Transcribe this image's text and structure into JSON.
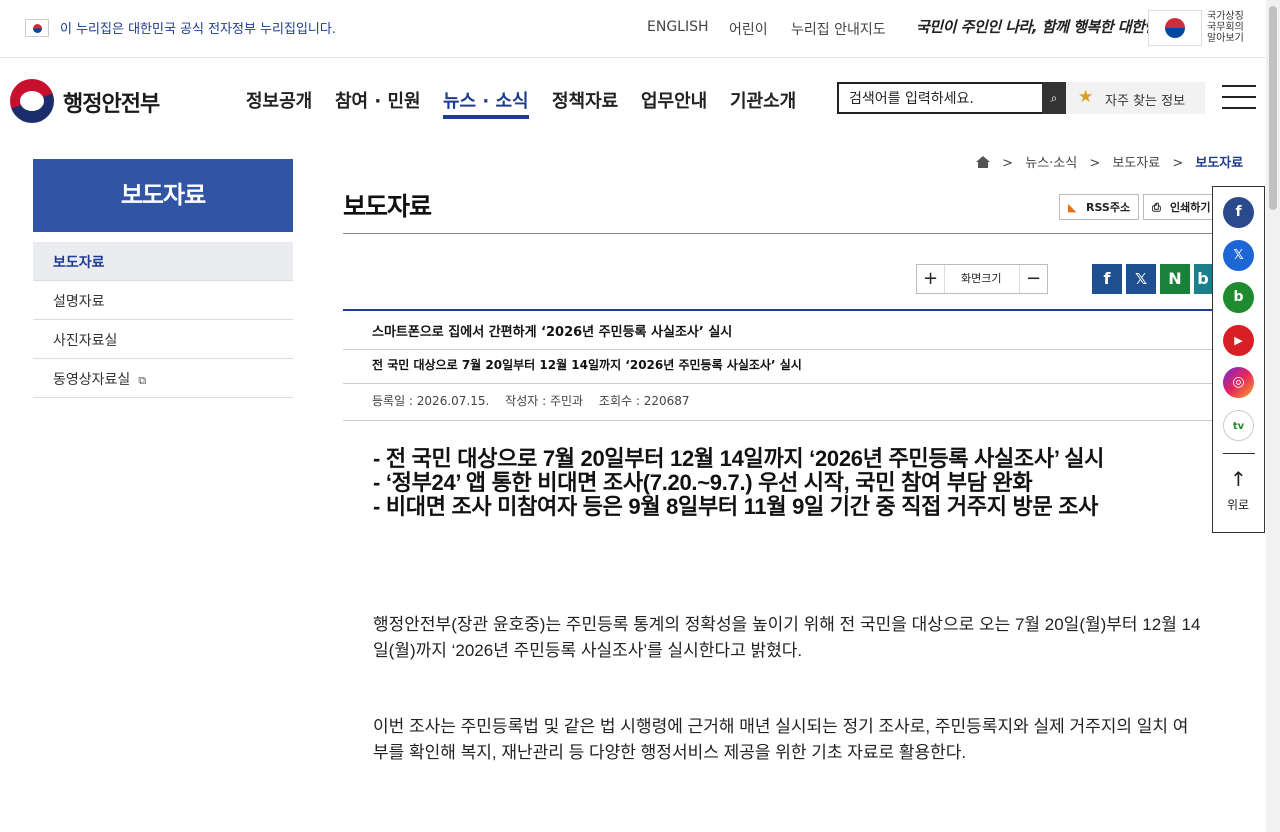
{
  "gov_banner": {
    "notice": "이 누리집은 대한민국 공식 전자정부 누리집입니다.",
    "links": [
      "ENGLISH",
      "어린이",
      "누리집 안내지도"
    ],
    "slogan": "국민이 주인인 나라, 함께 행복한 대한민국",
    "symbol_text": "국가상징\n국무회의\n알아보기"
  },
  "header": {
    "logo_text": "행정안전부",
    "nav": [
      "정보공개",
      "참여 · 민원",
      "뉴스 · 소식",
      "정책자료",
      "업무안내",
      "기관소개"
    ],
    "active_nav": "뉴스 · 소식",
    "search_placeholder": "검색어를 입력하세요.",
    "favorites": "자주 찾는 정보"
  },
  "lnb": {
    "title": "보도자료",
    "items": [
      "보도자료",
      "설명자료",
      "사진자료실",
      "동영상자료실"
    ]
  },
  "breadcrumb": [
    "뉴스·소식",
    "보도자료",
    "보도자료"
  ],
  "content": {
    "page_title": "보도자료",
    "rss": "RSS주소",
    "print": "인쇄하기",
    "zoom_label": "화면크기",
    "zoom_plus": "+",
    "zoom_minus": "−"
  },
  "share": [
    "f",
    "𝕏",
    "N",
    "b"
  ],
  "article": {
    "title": "스마트폰으로 집에서 간편하게 ‘2026년 주민등록 사실조사’ 실시",
    "subtitle": "전 국민 대상으로 7월 20일부터 12월 14일까지 ‘2026년 주민등록 사실조사’ 실시",
    "meta": {
      "date": "등록일 : 2026.07.15.",
      "author": "작성자 : 주민과",
      "views": "조회수 : 220687"
    },
    "summary": [
      "- 전 국민 대상으로 7월 20일부터 12월 14일까지 ‘2026년 주민등록 사실조사’ 실시",
      "- ‘정부24’ 앱 통한 비대면 조사(7.20.~9.7.) 우선 시작, 국민 참여 부담 완화",
      "- 비대면 조사 미참여자 등은 9월 8일부터 11월 9일 기간 중 직접 거주지 방문 조사"
    ],
    "paragraphs": [
      "행정안전부(장관 윤호중)는 주민등록 통계의 정확성을 높이기 위해 전 국민을 대상으로 오는 7월 20일(월)부터 12월 14일(월)까지 ‘2026년 주민등록 사실조사’를 실시한다고 밝혔다.",
      "이번 조사는 주민등록법 및 같은 법 시행령에 근거해 매년 실시되는 정기 조사로, 주민등록지와 실제 거주지의 일치 여부를 확인해 복지, 재난관리 등 다양한 행정서비스 제공을 위한 기초 자료로 활용한다."
    ]
  },
  "quick_menu": {
    "icons": [
      "f",
      "𝕏",
      "b",
      "▶",
      "◎",
      "tv"
    ],
    "up_label": "위로",
    "up_arrow": "↑"
  },
  "colors": {
    "primary": "#1d3c8f",
    "lnb_title": "#2f55a4",
    "facebook": "#3b5998",
    "x": "#1d9bf0",
    "naver": "#19a23b",
    "band": "#1d8b2e",
    "youtube": "#d81f26"
  }
}
